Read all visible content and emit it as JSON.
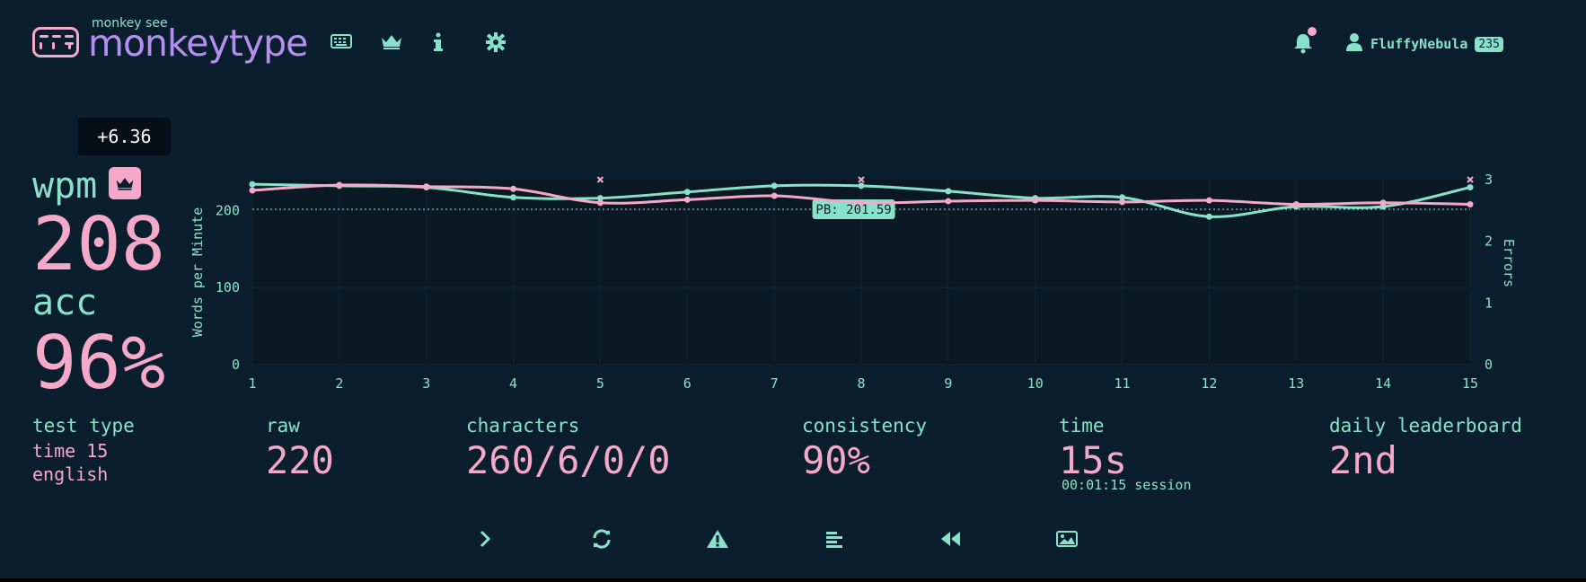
{
  "header": {
    "logo_sub": "monkey see",
    "logo_text": "monkeytype",
    "nav": [
      "keyboard-icon",
      "crown-icon",
      "info-icon",
      "gear-icon"
    ],
    "username": "FluffyNebula",
    "level": "235"
  },
  "result": {
    "tooltip": "+6.36",
    "wpm_label": "wpm",
    "wpm_value": "208",
    "acc_label": "acc",
    "acc_value": "96%"
  },
  "chart_data": {
    "type": "line",
    "x": [
      1,
      2,
      3,
      4,
      5,
      6,
      7,
      8,
      9,
      10,
      11,
      12,
      13,
      14,
      15
    ],
    "series": [
      {
        "name": "wpm",
        "color": "#f5a9c9",
        "values": [
          226,
          233,
          231,
          228,
          210,
          214,
          219,
          210,
          212,
          213,
          211,
          213,
          208,
          210,
          208
        ],
        "axis": "left"
      },
      {
        "name": "raw",
        "color": "#88e2c9",
        "values": [
          234,
          232,
          230,
          217,
          216,
          224,
          232,
          232,
          225,
          216,
          217,
          192,
          205,
          205,
          230
        ],
        "axis": "left"
      }
    ],
    "errors": {
      "color": "#f5a9c9",
      "x": [
        5,
        8,
        15
      ],
      "values": [
        3,
        3,
        3
      ]
    },
    "ylabel": "Words per Minute",
    "y2label": "Errors",
    "ylim": [
      0,
      240
    ],
    "y_ticks": [
      0,
      100,
      200
    ],
    "y2lim": [
      0,
      3
    ],
    "y2_ticks": [
      0,
      1,
      2,
      3
    ],
    "pb_line": {
      "value": 201.59,
      "label": "PB: 201.59"
    },
    "grid": true
  },
  "stats": {
    "test_type_label": "test type",
    "test_type_line1": "time 15",
    "test_type_line2": "english",
    "raw_label": "raw",
    "raw_value": "220",
    "characters_label": "characters",
    "characters_value": "260/6/0/0",
    "consistency_label": "consistency",
    "consistency_value": "90%",
    "time_label": "time",
    "time_value": "15s",
    "session_value": "00:01:15 session",
    "leaderboard_label": "daily leaderboard",
    "leaderboard_value": "2nd"
  },
  "actions": [
    "next-test-icon",
    "restart-icon",
    "report-icon",
    "words-history-icon",
    "replay-icon",
    "screenshot-icon"
  ],
  "colors": {
    "background": "#0b1e2d",
    "main": "#88e2c9",
    "text": "#f5a9c9",
    "logo": "#b48ef0"
  }
}
